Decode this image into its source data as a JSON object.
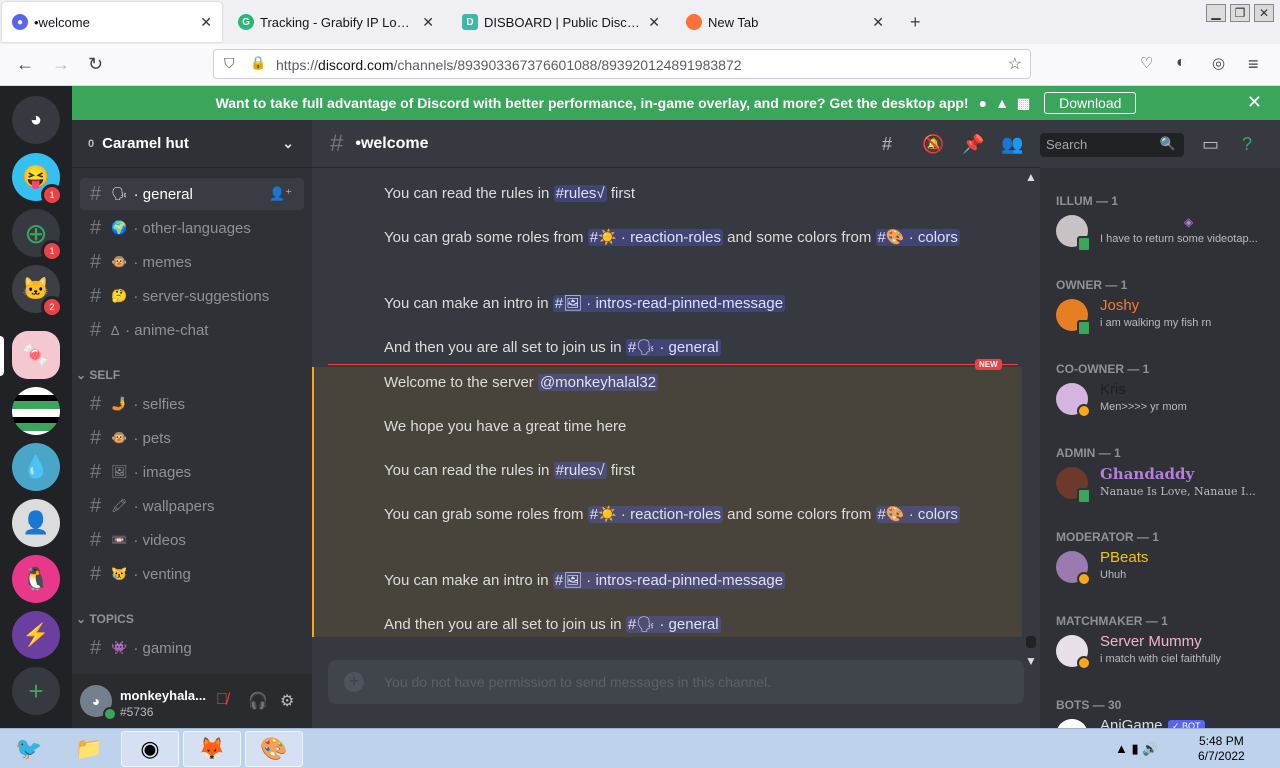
{
  "browser": {
    "tabs": [
      {
        "title": "•welcome",
        "favicon_color": "#5865f2"
      },
      {
        "title": "Tracking - Grabify IP Logger",
        "favicon_color": "#2bb673"
      },
      {
        "title": "DISBOARD | Public Discord S",
        "favicon_color": "#3db8a8"
      },
      {
        "title": "New Tab",
        "favicon_color": "#ff7139"
      }
    ],
    "url_domain": "discord.com",
    "url_prefix": "https://",
    "url_path": "/channels/893903367376601088/893920124891983872"
  },
  "banner": {
    "text": "Want to take full advantage of Discord with better performance, in-game overlay, and more? Get the desktop app!",
    "download_label": "Download"
  },
  "server": {
    "name": "Caramel hut",
    "boost_count": "0"
  },
  "channels": [
    {
      "emoji": "🗣",
      "name": "· general",
      "selected": true
    },
    {
      "emoji": "🌍",
      "name": "· other-languages"
    },
    {
      "emoji": "🐵",
      "name": "· memes"
    },
    {
      "emoji": "🤔",
      "name": "· server-suggestions"
    },
    {
      "emoji": "∆",
      "name": "· anime-chat"
    },
    {
      "emoji": "🤳",
      "name": "· selfies"
    },
    {
      "emoji": "🐵",
      "name": "· pets"
    },
    {
      "emoji": "🖼",
      "name": "· images"
    },
    {
      "emoji": "🖍",
      "name": "· wallpapers"
    },
    {
      "emoji": "📼",
      "name": "· videos"
    },
    {
      "emoji": "😿",
      "name": "· venting"
    },
    {
      "emoji": "👾",
      "name": "· gaming"
    }
  ],
  "categories": {
    "self": "SELF",
    "topics": "TOPICS"
  },
  "user": {
    "name": "monkeyhala...",
    "tag": "#5736"
  },
  "chat": {
    "channel": "•welcome",
    "search_placeholder": "Search",
    "new_label": "NEW",
    "composer_placeholder": "You do not have permission to send messages in this channel.",
    "messages": [
      {
        "pre": "You can read the rules in ",
        "mention": "#rules√",
        "post": " first"
      },
      {
        "pre": "You can grab some roles from ",
        "mention": "#☀️ · reaction-roles",
        "mid": " and some colors from ",
        "mention2": "#🎨 · colors"
      },
      {
        "pre": "You can make an intro in ",
        "mention": "#🖼 · intros-read-pinned-message"
      },
      {
        "pre": "And then you are all set to join us in ",
        "mention": "#🗣 · general"
      },
      {
        "pre": "Welcome to the server ",
        "mention": "@monkeyhalal32"
      },
      {
        "pre": "We hope you have a great time here"
      },
      {
        "pre": "You can read the rules in ",
        "mention": "#rules√",
        "post": " first"
      },
      {
        "pre": "You can grab some roles from ",
        "mention": "#☀️ · reaction-roles",
        "mid": " and some colors from ",
        "mention2": "#🎨 · colors"
      },
      {
        "pre": "You can make an intro in ",
        "mention": "#🖼 · intros-read-pinned-message"
      },
      {
        "pre": "And then you are all set to join us in ",
        "mention": "#🗣 · general"
      }
    ]
  },
  "members": {
    "groups": [
      {
        "label": "ILLUM — 1",
        "name": "",
        "name_color": "#5865f2",
        "activity": "I have to return some videotap...",
        "avatar_color": "#c9c2c4"
      },
      {
        "label": "OWNER — 1",
        "name": "Joshy",
        "name_color": "#f47b3a",
        "activity": "i am walking my fish rn",
        "avatar_color": "#e67e22"
      },
      {
        "label": "CO-OWNER — 1",
        "name": "Kris",
        "name_color": "#1e1f22",
        "activity": "Men>>>> yr mom",
        "avatar_color": "#d6b4e0"
      },
      {
        "label": "ADMIN — 1",
        "name": "Ghandaddy",
        "name_color": "#b57edc",
        "activity": "Nanaue Is Love, Nanaue I...",
        "avatar_color": "#6b3a2a"
      },
      {
        "label": "MODERATOR — 1",
        "name": "PBeats",
        "name_color": "#f1c40f",
        "activity": "Uhuh",
        "avatar_color": "#9b7ab0"
      },
      {
        "label": "MATCHMAKER — 1",
        "name": "Server Mummy",
        "name_color": "#f5b5c8",
        "activity": "i match with ciel faithfully",
        "avatar_color": "#e8e0e8"
      },
      {
        "label": "BOTS — 30",
        "name": "AniGame",
        "name_color": "#dcddde",
        "activity": "",
        "avatar_color": "#ffffff"
      }
    ],
    "bot_badge": "✓ BOT"
  },
  "taskbar": {
    "time": "5:48 PM",
    "date": "6/7/2022"
  }
}
